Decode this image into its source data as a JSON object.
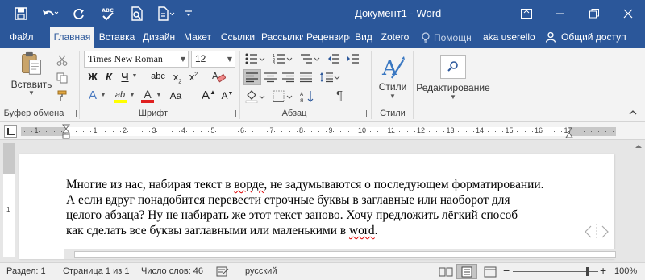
{
  "window": {
    "title": "Документ1 - Word"
  },
  "tabs": {
    "file": "Файл",
    "items": [
      "Главная",
      "Вставка",
      "Дизайн",
      "Макет",
      "Ссылки",
      "Рассылки",
      "Рецензирование",
      "Вид",
      "Zotero"
    ],
    "tell_me": "Помощник",
    "user": "aka userello",
    "share": "Общий доступ"
  },
  "ribbon": {
    "clipboard": {
      "paste": "Вставить",
      "label": "Буфер обмена"
    },
    "font": {
      "name": "Times New Roman",
      "size": "12",
      "bold": "Ж",
      "italic": "К",
      "underline": "Ч",
      "strike": "abc",
      "subscript": "x",
      "superscript": "x",
      "grow": "A",
      "shrink": "A",
      "case": "Aa",
      "effects": "A",
      "highlight": "ab",
      "color": "A",
      "label": "Шрифт"
    },
    "paragraph": {
      "label": "Абзац",
      "pilcrow": "¶"
    },
    "styles": {
      "label": "Стили",
      "button": "Стили"
    },
    "editing": {
      "button": "Редактирование"
    }
  },
  "ruler": {
    "numbers": [
      "1",
      "2",
      "1",
      "2",
      "3",
      "4",
      "5",
      "6",
      "7",
      "8",
      "9",
      "10",
      "11",
      "12",
      "13",
      "14",
      "15",
      "16",
      "17"
    ]
  },
  "document": {
    "lines": [
      {
        "pre": "Многие из нас, набирая текст в ",
        "err": "ворде",
        "post": ", не задумываются о последующем форматировании."
      },
      {
        "pre": "А если вдруг понадобится перевести строчные буквы в заглавные или наоборот для",
        "err": "",
        "post": ""
      },
      {
        "pre": "целого абзаца? Ну не набирать же этот текст заново. Хочу предложить лёгкий способ",
        "err": "",
        "post": ""
      },
      {
        "pre": "как сделать все буквы заглавными или маленькими в ",
        "err": "word",
        "post": "."
      }
    ]
  },
  "status": {
    "section": "Раздел: 1",
    "page": "Страница 1 из 1",
    "words": "Число слов: 46",
    "language": "русский",
    "zoom_minus": "−",
    "zoom_plus": "+",
    "zoom": "100%",
    "zoom_level": 1.0
  },
  "colors": {
    "brand": "#2b579a",
    "ribbon": "#f3f3f3",
    "spell_error": "#d00000"
  },
  "icons": [
    "save-icon",
    "undo-icon",
    "redo-icon",
    "spelling-icon",
    "print-preview-icon",
    "quick-access-customize-icon",
    "paste-icon",
    "cut-icon",
    "copy-icon",
    "format-painter-icon",
    "styles-icon",
    "search-icon",
    "lightbulb-icon",
    "person-icon"
  ]
}
